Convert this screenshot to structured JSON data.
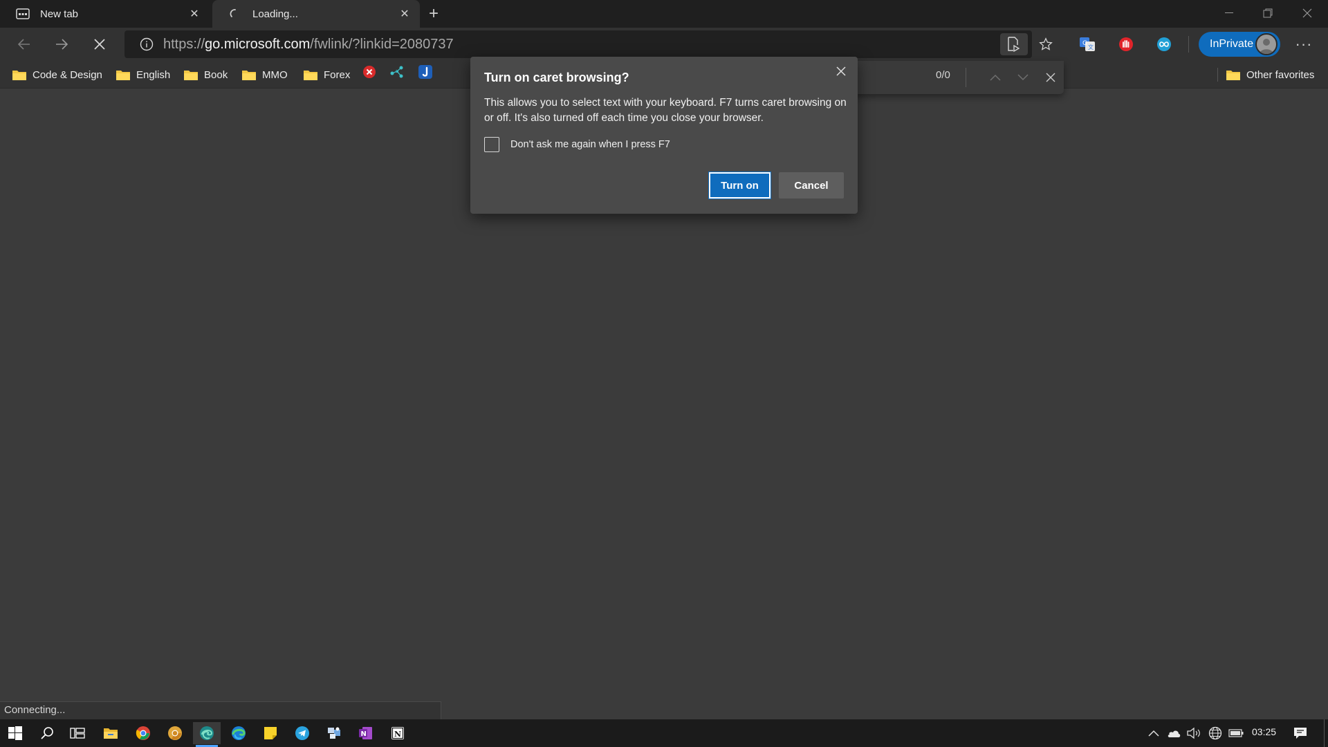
{
  "browser": {
    "tabs": [
      {
        "label": "New tab",
        "state": "inactive"
      },
      {
        "label": "Loading...",
        "state": "active-loading"
      }
    ],
    "address": {
      "url_prefix": "https://",
      "url_host": "go.microsoft.com",
      "url_path": "/fwlink/?linkid=2080737"
    },
    "inprivate_label": "InPrivate",
    "favorites": [
      {
        "label": "Code & Design",
        "icon": "folder-icon"
      },
      {
        "label": "English",
        "icon": "folder-icon"
      },
      {
        "label": "Book",
        "icon": "folder-icon"
      },
      {
        "label": "MMO",
        "icon": "folder-icon"
      },
      {
        "label": "Forex",
        "icon": "folder-icon"
      }
    ],
    "favorite_icons": [
      "x-site-icon",
      "share-nodes-icon",
      "j-site-icon"
    ],
    "other_favorites": "Other favorites",
    "find": {
      "count": "0/0"
    },
    "status": "Connecting..."
  },
  "dialog": {
    "title": "Turn on caret browsing?",
    "body": "This allows you to select text with your keyboard. F7 turns caret browsing on or off. It's also turned off each time you close your browser.",
    "checkbox_label": "Don't ask me again when I press F7",
    "checkbox_checked": false,
    "primary_button": "Turn on",
    "secondary_button": "Cancel"
  },
  "taskbar": {
    "clock": "03:25",
    "apps": [
      "windows-start-icon",
      "search-icon",
      "task-view-icon",
      "file-explorer-icon",
      "chrome-icon",
      "chrome-canary-icon",
      "edge-dev-icon",
      "edge-icon",
      "sticky-notes-icon",
      "telegram-icon",
      "app-icon",
      "onenote-icon",
      "notion-icon"
    ]
  },
  "colors": {
    "accent": "#0f6cbd",
    "page_bg": "#3b3b3b",
    "dialog_bg": "#4a4a4a"
  }
}
